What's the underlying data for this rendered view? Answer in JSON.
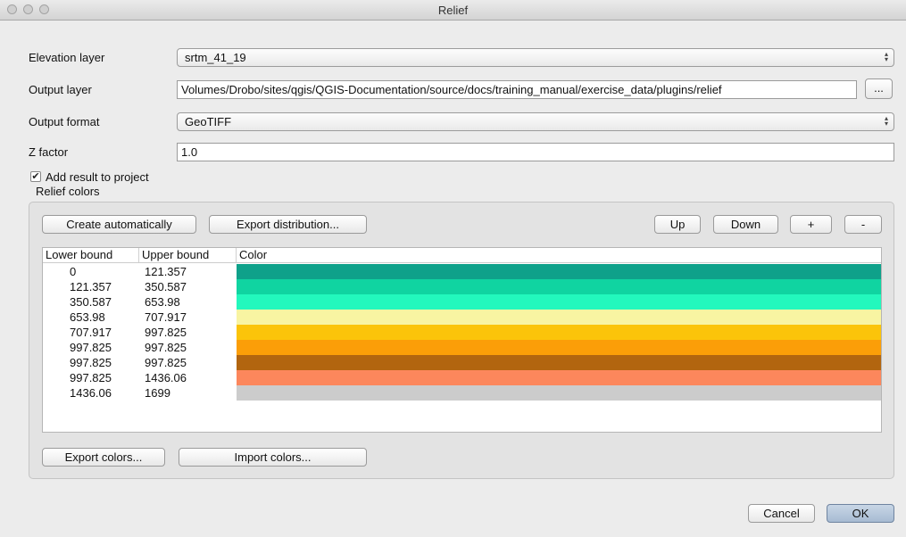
{
  "window": {
    "title": "Relief"
  },
  "form": {
    "elevation_label": "Elevation layer",
    "elevation_value": "srtm_41_19",
    "output_label": "Output layer",
    "output_value": "Volumes/Drobo/sites/qgis/QGIS-Documentation/source/docs/training_manual/exercise_data/plugins/relief",
    "browse_label": "...",
    "format_label": "Output format",
    "format_value": "GeoTIFF",
    "zfactor_label": "Z factor",
    "zfactor_value": "1.0",
    "add_result_label": "Add result to project",
    "add_result_checked": true
  },
  "relief": {
    "group_label": "Relief colors",
    "create_auto": "Create automatically",
    "export_dist": "Export distribution...",
    "up": "Up",
    "down": "Down",
    "plus": "+",
    "minus": "-",
    "columns": [
      "Lower bound",
      "Upper bound",
      "Color"
    ],
    "rows": [
      {
        "lower": "0",
        "upper": "121.357",
        "color": "#0fa18a"
      },
      {
        "lower": "121.357",
        "upper": "350.587",
        "color": "#10d4a1"
      },
      {
        "lower": "350.587",
        "upper": "653.98",
        "color": "#23f8bd"
      },
      {
        "lower": "653.98",
        "upper": "707.917",
        "color": "#f8f4a2"
      },
      {
        "lower": "707.917",
        "upper": "997.825",
        "color": "#fbc40a"
      },
      {
        "lower": "997.825",
        "upper": "997.825",
        "color": "#fb9e08"
      },
      {
        "lower": "997.825",
        "upper": "997.825",
        "color": "#b2650f"
      },
      {
        "lower": "997.825",
        "upper": "1436.06",
        "color": "#fc875c"
      },
      {
        "lower": "1436.06",
        "upper": "1699",
        "color": "#cccccc"
      }
    ],
    "export_colors": "Export colors...",
    "import_colors": "Import colors..."
  },
  "footer": {
    "cancel": "Cancel",
    "ok": "OK"
  }
}
